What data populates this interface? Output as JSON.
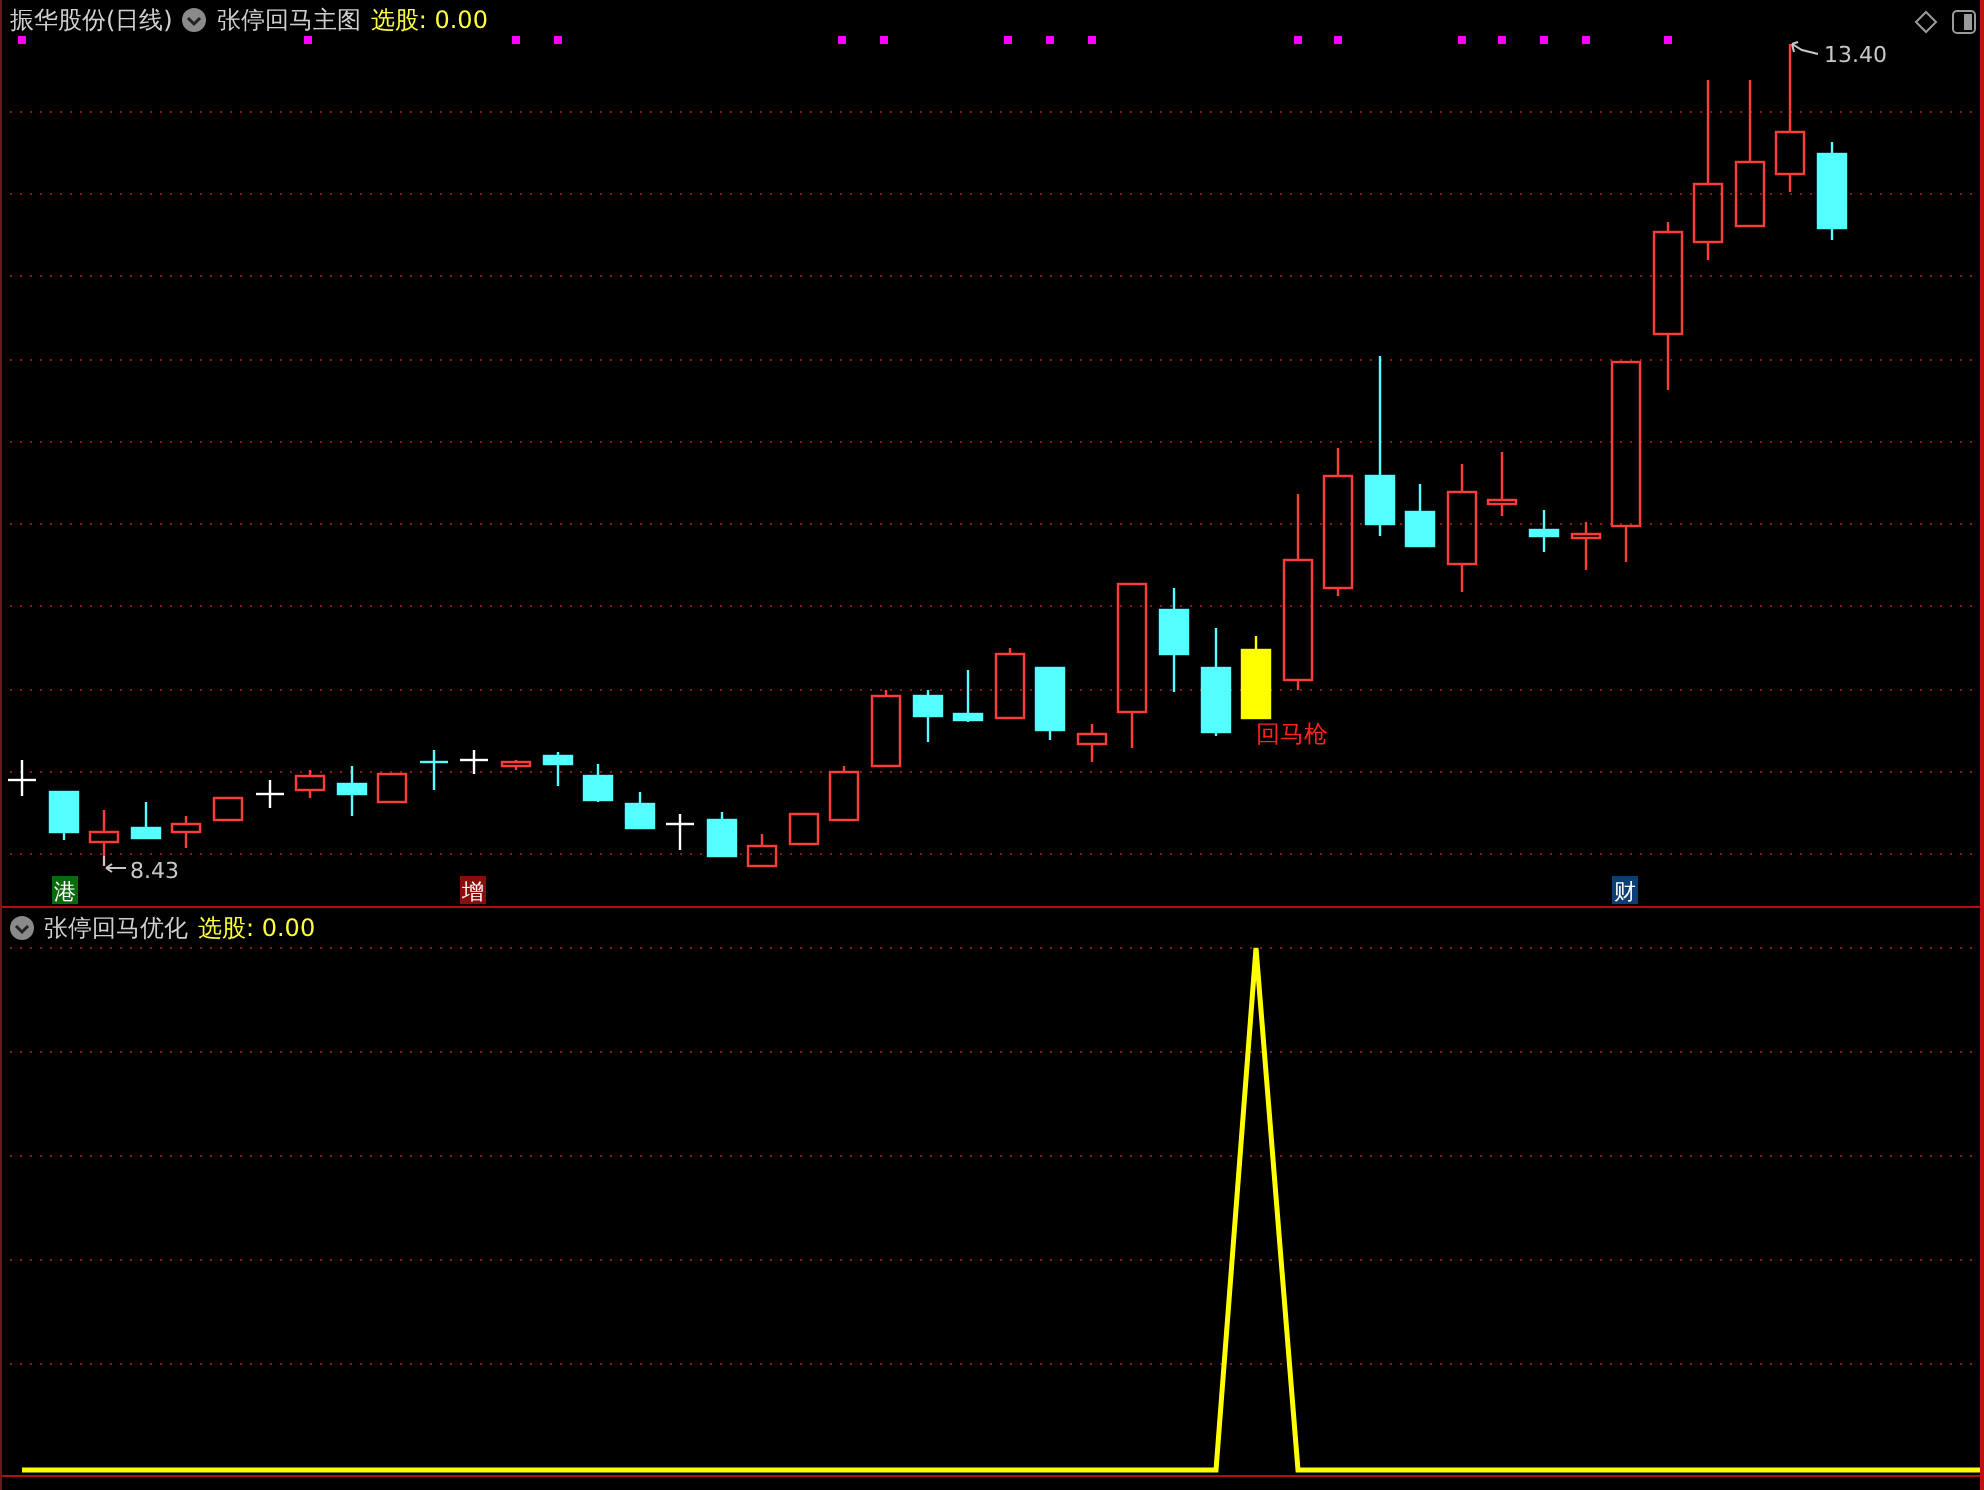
{
  "main_panel": {
    "stock": "振华股份(日线)",
    "indicator": "张停回马主图",
    "signal": "选股: 0.00",
    "low_label": "8.43",
    "high_label": "13.40",
    "signal_label": "回马枪",
    "badges": [
      {
        "text": "港",
        "color": "#0b6b0b"
      },
      {
        "text": "增",
        "color": "#8a0c0c"
      },
      {
        "text": "财",
        "color": "#0c3d73"
      }
    ]
  },
  "sub_panel": {
    "indicator": "张停回马优化",
    "signal": "选股: 0.00"
  }
}
